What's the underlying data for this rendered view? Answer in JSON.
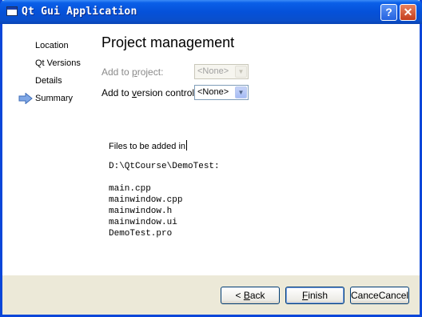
{
  "window": {
    "title": "Qt Gui Application",
    "help_glyph": "?",
    "close_glyph": "✕",
    "icon": "app-window-icon"
  },
  "sidebar": {
    "items": [
      {
        "label": "Location",
        "active": false
      },
      {
        "label": "Qt Versions",
        "active": false
      },
      {
        "label": "Details",
        "active": false
      },
      {
        "label": "Summary",
        "active": true
      }
    ],
    "active_marker_icon": "arrow-right-icon"
  },
  "page": {
    "title": "Project management",
    "add_to_project": {
      "label": "Add to project:",
      "value": "<None>",
      "enabled": false
    },
    "add_to_vcs": {
      "label": "Add to version control:",
      "value": "<None>",
      "enabled": true
    },
    "files_heading": "Files to be added in",
    "path": "D:\\QtCourse\\DemoTest:",
    "files": [
      "main.cpp",
      "mainwindow.cpp",
      "mainwindow.h",
      "mainwindow.ui",
      "DemoTest.pro"
    ]
  },
  "buttons": {
    "back": "< Back",
    "finish": "Finish",
    "cancel": "Cancel"
  },
  "colors": {
    "titlebar": "#0551d9",
    "dialog_bg": "#ece9d8",
    "arrow": "#5b8fd8"
  }
}
